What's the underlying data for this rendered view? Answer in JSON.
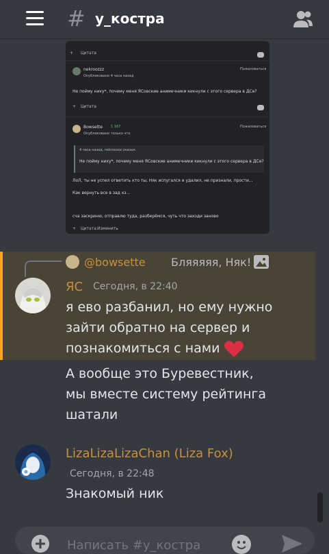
{
  "header": {
    "channel_name": "у_костра",
    "hash_symbol": "#"
  },
  "embedded_screenshot": {
    "top_quote_label": "Цитата",
    "post1": {
      "author": "nekroozzz",
      "posted": "Опубликовано 4 часа назад",
      "complaint": "Пожаловаться",
      "text": "Не пойму ниху*, почему меня ЯСовские анимечники кикнули с этого сервера в ДСе?",
      "quote_label": "Цитата"
    },
    "post2": {
      "author": "Bowsette",
      "level": "1 167",
      "posted": "Опубликовано только что",
      "complaint": "Пожаловаться",
      "quote_header": "4 часа назад, nekroozzz сказал:",
      "quote_text": "Не пойму ниху*, почему меня ЯСовские анимечники кикнули с этого сервера в ДСе?",
      "line1": "ЛоЛ, ты не успел ответить кто ты, Няк испугался и удалил, не признали, прости...",
      "line2": "Как вернуть все в зад хз...",
      "line3": "сча заскриню, отправлю туда, разберёмся, чуть что заходи заново",
      "quote_label": "Цитата",
      "edit_label": "Изменить"
    }
  },
  "reply": {
    "name": "@bowsette",
    "text": "Бляяяяя, Няк!!! Ве"
  },
  "message1": {
    "author": "ЯС",
    "author_color": "#c8913a",
    "timestamp": "Сегодня, в 22:40",
    "lines": [
      "я ево разбанил, но ему нужно",
      "зайти обратно на сервер и",
      "познакомиться с нами"
    ],
    "extra_lines": [
      "А вообще это Буревестник,",
      "мы вместе систему рейтинга",
      "шатали"
    ]
  },
  "message2": {
    "author": "LizaLizaLizaChan (Liza Fox)",
    "author_color": "#c8913a",
    "timestamp": "Сегодня, в 22:48",
    "text": "Знакомый ник"
  },
  "input": {
    "placeholder": "Написать #у_костра"
  }
}
